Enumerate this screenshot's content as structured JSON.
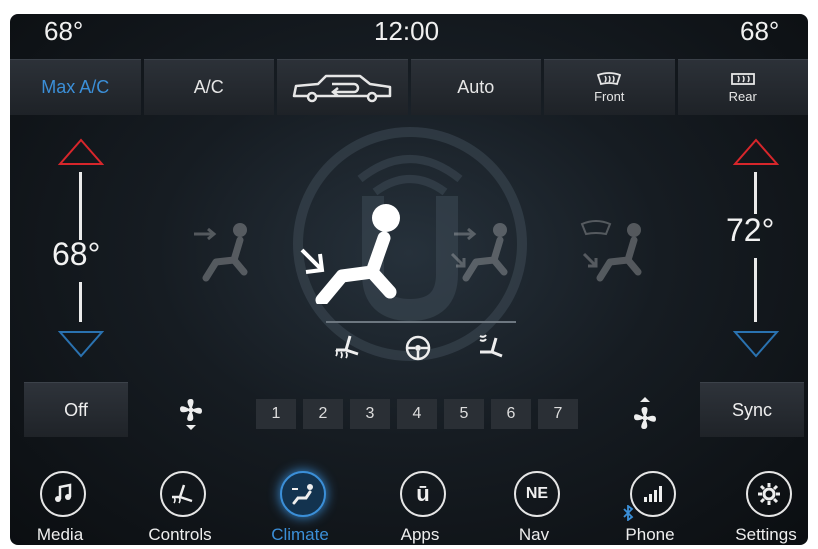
{
  "status": {
    "left_temp": "68°",
    "clock": "12:00",
    "right_temp": "68°"
  },
  "top_buttons": {
    "max_ac": "Max A/C",
    "ac": "A/C",
    "recirc_icon": "recirculation-car-icon",
    "auto": "Auto",
    "front": "Front",
    "rear": "Rear"
  },
  "driver": {
    "temp": "68°"
  },
  "passenger": {
    "temp": "72°"
  },
  "controls": {
    "off": "Off",
    "sync": "Sync"
  },
  "fan_speeds": [
    "1",
    "2",
    "3",
    "4",
    "5",
    "6",
    "7"
  ],
  "nav": {
    "media": "Media",
    "controls": "Controls",
    "climate": "Climate",
    "apps": "Apps",
    "nav_label": "Nav",
    "compass": "NE",
    "phone": "Phone",
    "settings": "Settings",
    "apps_badge": "ū"
  },
  "colors": {
    "accent": "#3b8fd8",
    "up_arrow": "#d7262b",
    "down_arrow": "#2a72b0"
  }
}
